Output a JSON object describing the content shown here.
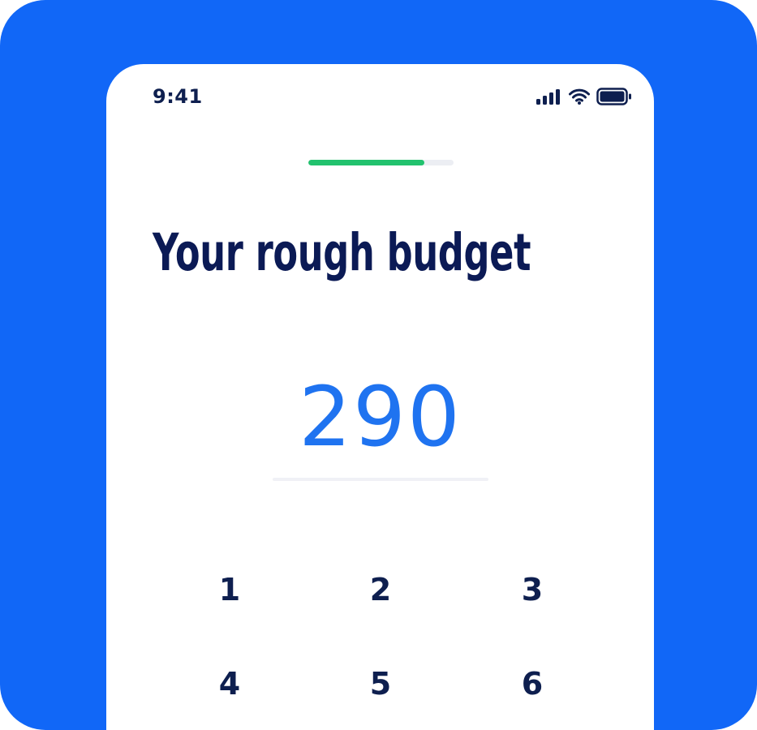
{
  "status_bar": {
    "time": "9:41",
    "icons": [
      "signal-icon",
      "wifi-icon",
      "battery-icon"
    ]
  },
  "progress": {
    "fraction": 0.8,
    "fill_color": "#22c26e",
    "track_color": "#eceef3"
  },
  "screen": {
    "title": "Your rough budget"
  },
  "amount": {
    "value": "290"
  },
  "keypad": {
    "keys": [
      "1",
      "2",
      "3",
      "4",
      "5",
      "6"
    ]
  },
  "colors": {
    "background": "#1167f7",
    "title": "#0b1a55",
    "amount": "#1f73f0",
    "key_text": "#0e1f4f"
  }
}
